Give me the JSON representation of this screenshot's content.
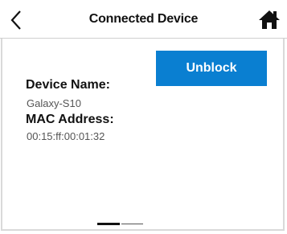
{
  "header": {
    "title": "Connected Device"
  },
  "actions": {
    "unblock_label": "Unblock"
  },
  "device": {
    "name_label": "Device Name:",
    "name_value": "Galaxy-S10",
    "mac_label": "MAC Address:",
    "mac_value": "00:15:ff:00:01:32"
  },
  "pager": {
    "pages": 2,
    "current": 1
  },
  "colors": {
    "accent": "#0a7fd1",
    "text": "#111111",
    "muted": "#555555"
  },
  "icons": {
    "back": "chevron-left-icon",
    "home": "home-icon"
  }
}
